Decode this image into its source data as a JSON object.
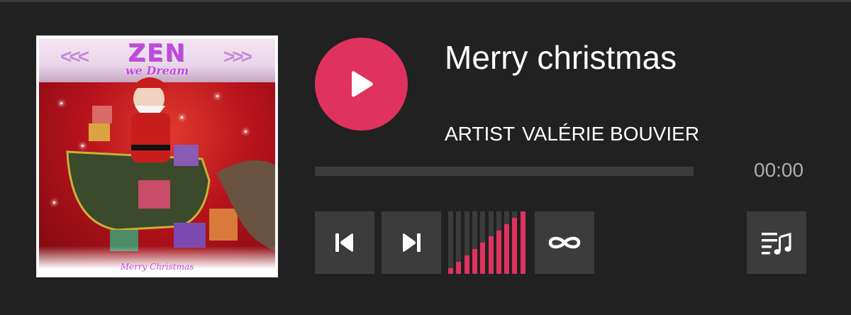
{
  "player": {
    "album_art": {
      "brand": "ZEN",
      "subtitle": "we Dream",
      "caption": "Merry Christmas"
    },
    "track_title": "Merry christmas",
    "artist_label": "ARTIST",
    "artist_name": "VALÉRIE BOUVIER",
    "time": "00:00",
    "progress_fraction": 0.0,
    "volume_level_fraction": 1.0,
    "controls": {
      "play_icon": "play-icon",
      "previous_icon": "skip-previous-icon",
      "next_icon": "skip-next-icon",
      "repeat_icon": "repeat-icon",
      "playlist_icon": "playlist-icon"
    },
    "colors": {
      "background": "#212121",
      "accent": "#e0325f",
      "control_bg": "#3c3c3c",
      "text": "#ffffff",
      "muted_text": "#aeaeae"
    }
  }
}
